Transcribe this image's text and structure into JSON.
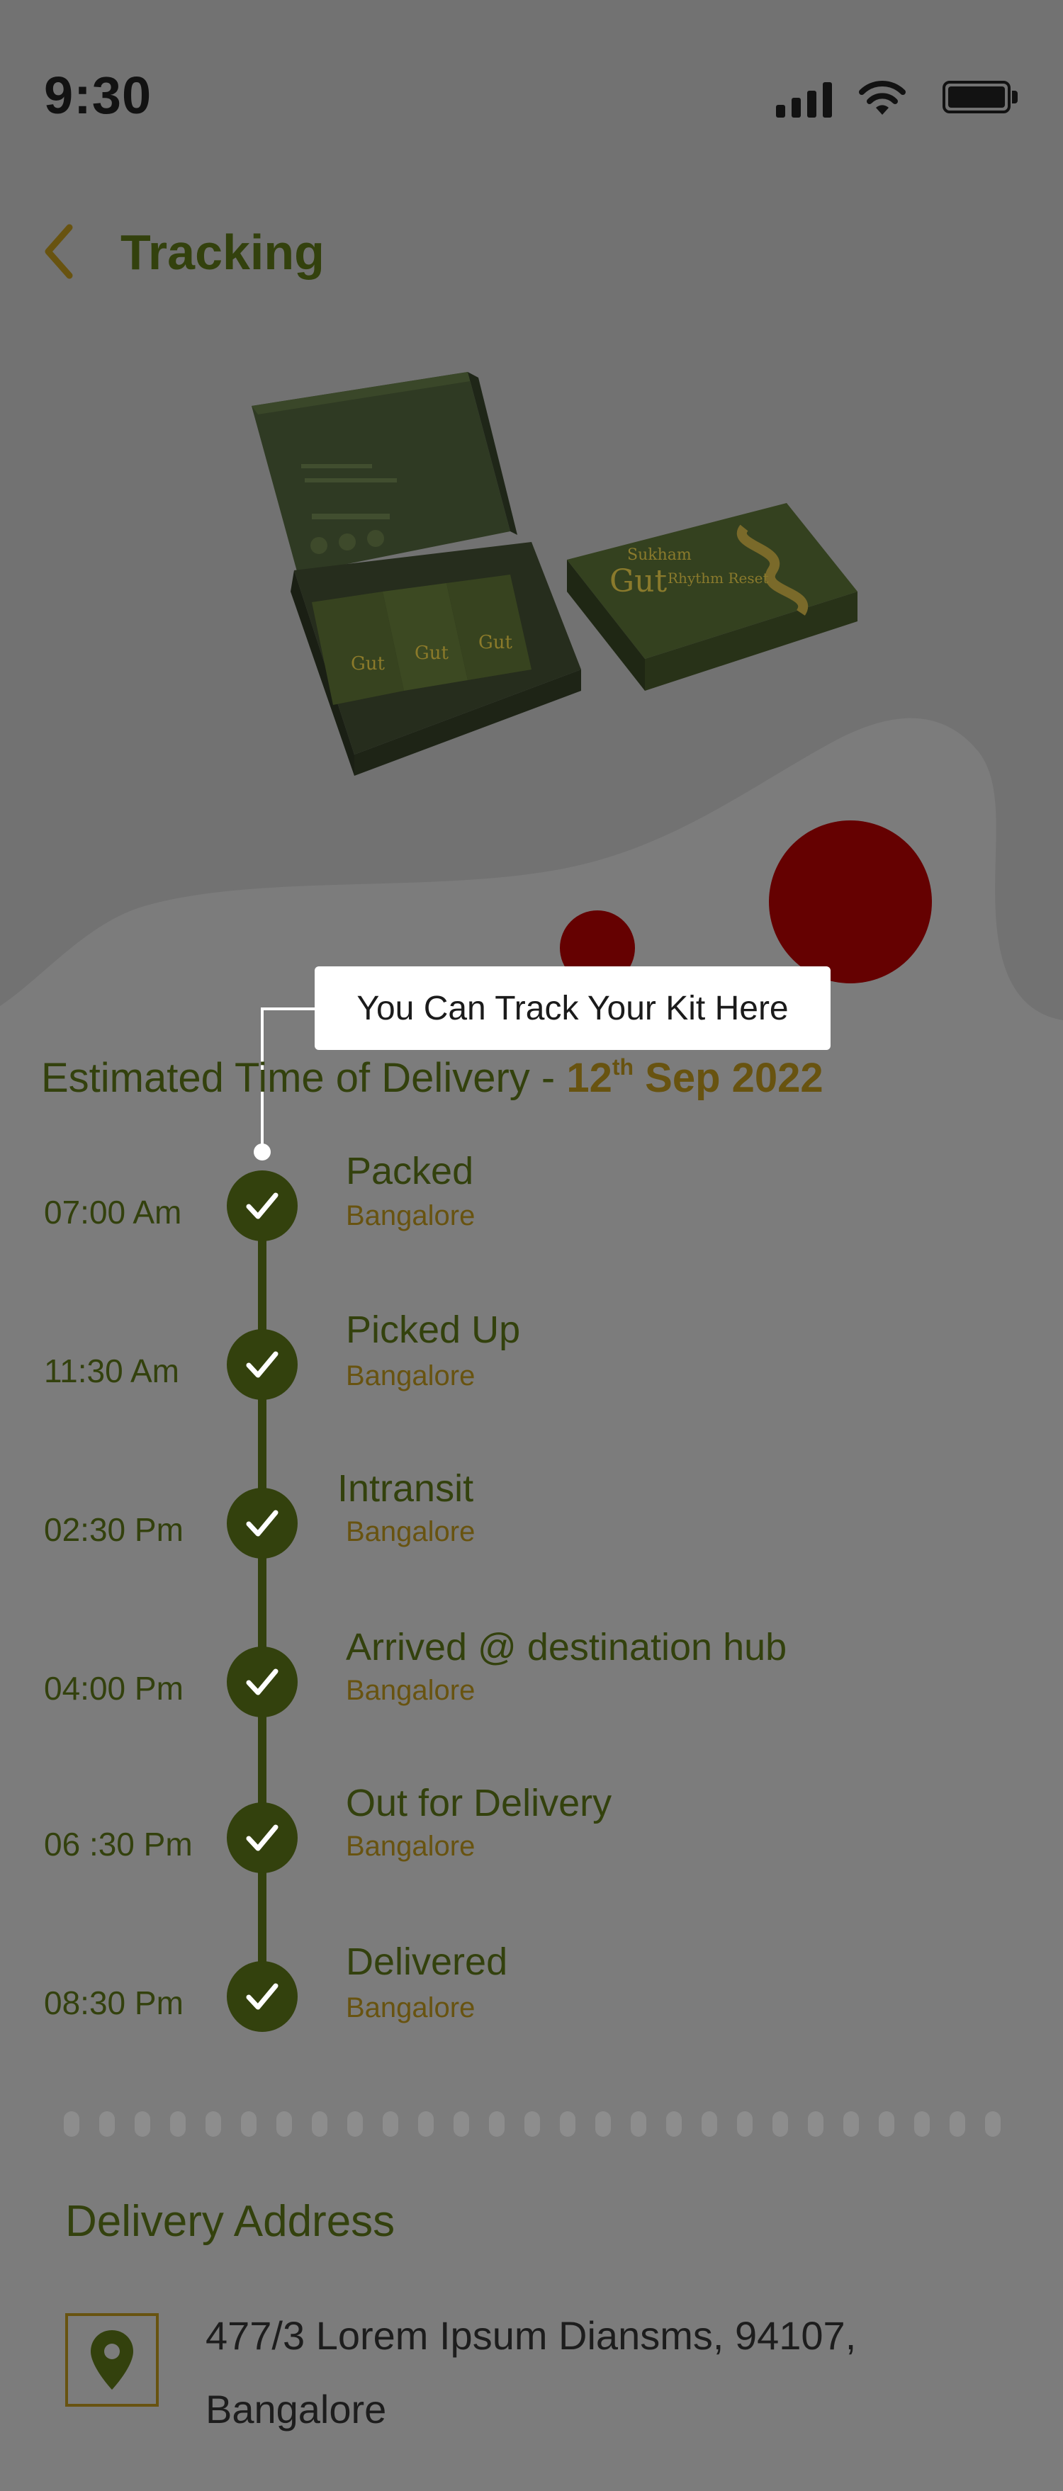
{
  "status_bar": {
    "time": "9:30"
  },
  "header": {
    "title": "Tracking"
  },
  "tooltip": {
    "text": "You Can Track Your Kit Here"
  },
  "eta": {
    "label": "Estimated Time of Delivery - ",
    "day": "12",
    "suffix": "th",
    "month_year": " Sep 2022"
  },
  "timeline": [
    {
      "time": "07:00 Am",
      "status": "Packed",
      "place": "Bangalore"
    },
    {
      "time": "11:30 Am",
      "status": "Picked Up",
      "place": "Bangalore"
    },
    {
      "time": "02:30 Pm",
      "status": "Intransit",
      "place": "Bangalore"
    },
    {
      "time": "04:00 Pm",
      "status": "Arrived @ destination hub",
      "place": "Bangalore"
    },
    {
      "time": "06 :30 Pm",
      "status": "Out for Delivery",
      "place": "Bangalore"
    },
    {
      "time": "08:30 Pm",
      "status": "Delivered",
      "place": "Bangalore"
    }
  ],
  "delivery": {
    "title": "Delivery Address",
    "address": "477/3 Lorem Ipsum Diansms, 94107, Bangalore"
  },
  "product_box": {
    "brand": "Sukham",
    "name": "Gut",
    "subtitle": "Rhythm Reset"
  },
  "colors": {
    "primary": "#33410d",
    "accent": "#685310",
    "dot": "#650101",
    "bg": "#7c7c7c"
  }
}
